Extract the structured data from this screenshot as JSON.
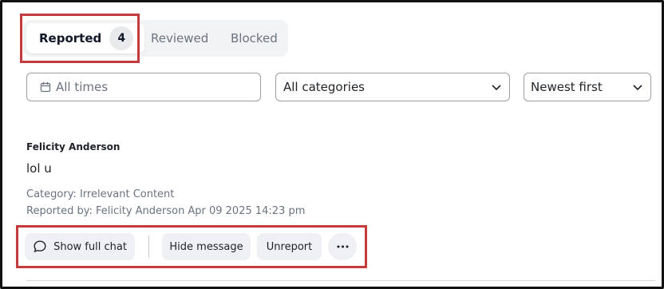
{
  "tabs": [
    {
      "label": "Reported",
      "count": "4",
      "active": true
    },
    {
      "label": "Reviewed"
    },
    {
      "label": "Blocked"
    }
  ],
  "filters": {
    "date_value": "All times",
    "category_value": "All categories",
    "sort_value": "Newest first"
  },
  "report": {
    "author": "Felicity Anderson",
    "message": "lol u",
    "category": "Category: Irrelevant Content",
    "reported_by": "Reported by: Felicity Anderson",
    "reported_at": "Apr 09 2025 14:23 pm"
  },
  "actions": {
    "show_full_chat": "Show full chat",
    "hide_message": "Hide message",
    "unreport": "Unreport",
    "more": "•••"
  },
  "icons": {
    "calendar": "calendar-icon",
    "chevron": "chevron-down-icon",
    "chat": "chat-bubble-icon",
    "more": "more-horizontal-icon"
  },
  "colors": {
    "highlight": "#c53a3a",
    "tab_bg": "#f2f3f5",
    "button_bg": "#eef0f3"
  }
}
